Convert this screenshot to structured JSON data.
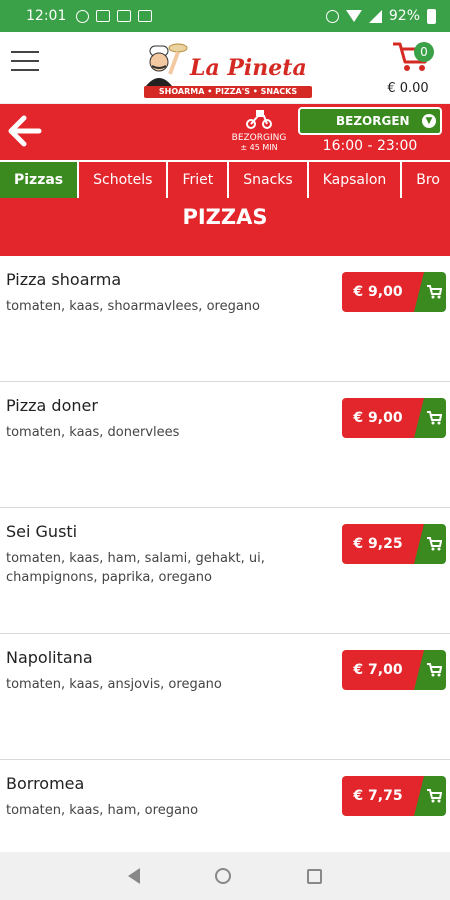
{
  "status_bar": {
    "time": "12:01",
    "battery": "92%"
  },
  "header": {
    "logo_title": "La Pineta",
    "logo_subtitle": "SHOARMA • PIZZA'S • SNACKS",
    "cart_count": "0",
    "cart_total": "€ 0.00"
  },
  "delivery": {
    "label": "BEZORGING",
    "time": "± 45 MIN",
    "mode_button": "BEZORGEN",
    "hours": "16:00 - 23:00"
  },
  "tabs": [
    "Pizzas",
    "Schotels",
    "Friet",
    "Snacks",
    "Kapsalon",
    "Bro"
  ],
  "section_title": "PIZZAS",
  "products": [
    {
      "name": "Pizza shoarma",
      "description": "tomaten, kaas, shoarmavlees, oregano",
      "price": "€ 9,00"
    },
    {
      "name": "Pizza doner",
      "description": "tomaten, kaas, donervlees",
      "price": "€ 9,00"
    },
    {
      "name": "Sei Gusti",
      "description": "tomaten, kaas, ham, salami, gehakt, ui, champignons, paprika, oregano",
      "price": "€ 9,25"
    },
    {
      "name": "Napolitana",
      "description": "tomaten, kaas, ansjovis, oregano",
      "price": "€ 7,00"
    },
    {
      "name": "Borromea",
      "description": "tomaten, kaas, ham, oregano",
      "price": "€ 7,75"
    }
  ],
  "colors": {
    "status_green": "#3aa148",
    "brand_red": "#e3262b",
    "brand_green": "#3a8a1f"
  }
}
